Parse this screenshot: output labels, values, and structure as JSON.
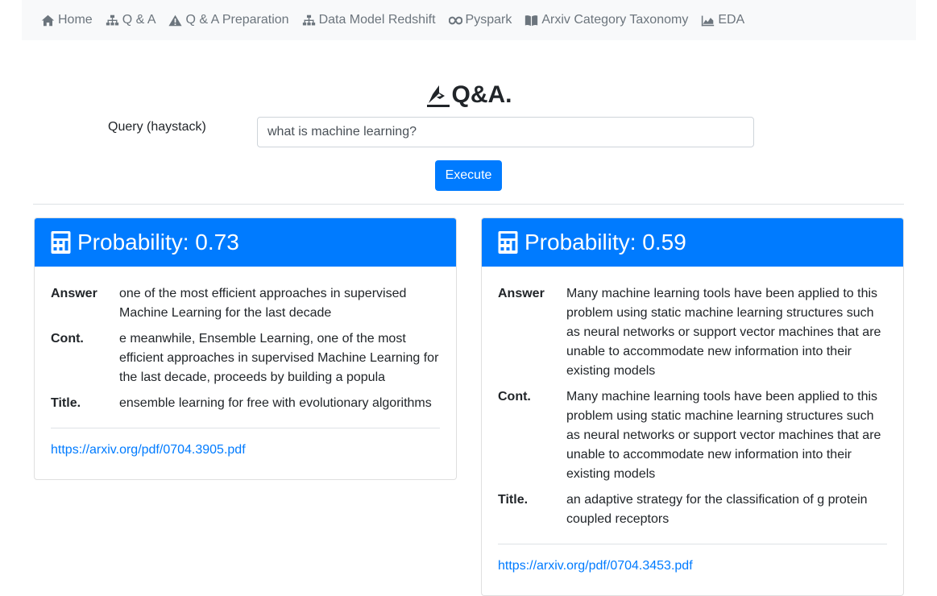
{
  "nav": {
    "items": [
      {
        "label": "Home",
        "icon": "home-icon"
      },
      {
        "label": "Q & A",
        "icon": "sitemap-icon"
      },
      {
        "label": "Q & A Preparation",
        "icon": "warning-icon"
      },
      {
        "label": "Data Model Redshift",
        "icon": "sitemap-icon"
      },
      {
        "label": "Pyspark",
        "icon": "infinity-icon"
      },
      {
        "label": "Arxiv Category Taxonomy",
        "icon": "book-icon"
      },
      {
        "label": "EDA",
        "icon": "chart-area-icon"
      }
    ]
  },
  "brand": {
    "title": "Q&A.",
    "icon": "ship-icon"
  },
  "query": {
    "label": "Query (haystack)",
    "value": "what is machine learning?"
  },
  "execute_label": "Execute",
  "colors": {
    "accent": "#007bff",
    "nav_bg": "#f8f9fa",
    "nav_text": "#6c757d"
  },
  "results": [
    {
      "header": "Probability: 0.73",
      "answer_label": "Answer",
      "answer": "one of the most efficient approaches in supervised Machine Learning for the last decade",
      "context_label": "Cont.",
      "context": "e meanwhile, Ensemble Learning, one of the most efficient approaches in supervised Machine Learning for the last decade, proceeds by building a popula",
      "title_label": "Title.",
      "title": "ensemble learning for free with evolutionary algorithms",
      "link": "https://arxiv.org/pdf/0704.3905.pdf"
    },
    {
      "header": "Probability: 0.59",
      "answer_label": "Answer",
      "answer": "Many machine learning tools have been applied to this problem using static machine learning structures such as neural networks or support vector machines that are unable to accommodate new information into their existing models",
      "context_label": "Cont.",
      "context": "Many machine learning tools have been applied to this problem using static machine learning structures such as neural networks or support vector machines that are unable to accommodate new information into their existing models",
      "title_label": "Title.",
      "title": "an adaptive strategy for the classification of g protein coupled receptors",
      "link": "https://arxiv.org/pdf/0704.3453.pdf"
    }
  ]
}
